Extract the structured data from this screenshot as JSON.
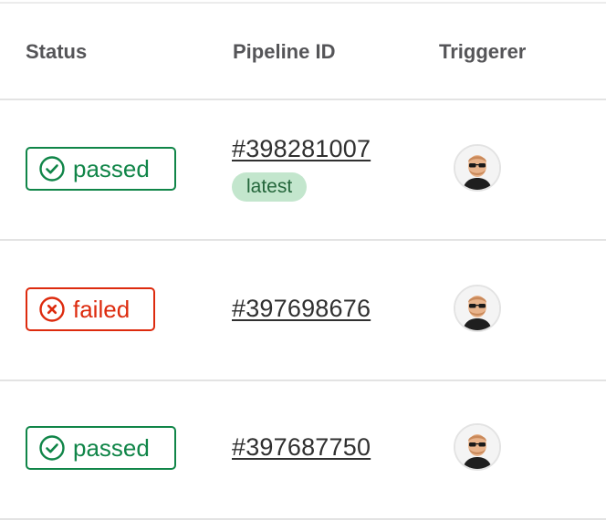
{
  "columns": {
    "status": "Status",
    "pipeline_id": "Pipeline ID",
    "triggerer": "Triggerer"
  },
  "rows": [
    {
      "status": "passed",
      "status_label": "passed",
      "pipeline_id": "#398281007",
      "tag": "latest",
      "triggerer_avatar": "user-avatar-icon"
    },
    {
      "status": "failed",
      "status_label": "failed",
      "pipeline_id": "#397698676",
      "triggerer_avatar": "user-avatar-icon"
    },
    {
      "status": "passed",
      "status_label": "passed",
      "pipeline_id": "#397687750",
      "triggerer_avatar": "user-avatar-icon"
    }
  ],
  "colors": {
    "passed": "#108548",
    "failed": "#dd2b0e",
    "latest_bg": "#c3e6cd",
    "latest_text": "#24663b"
  }
}
